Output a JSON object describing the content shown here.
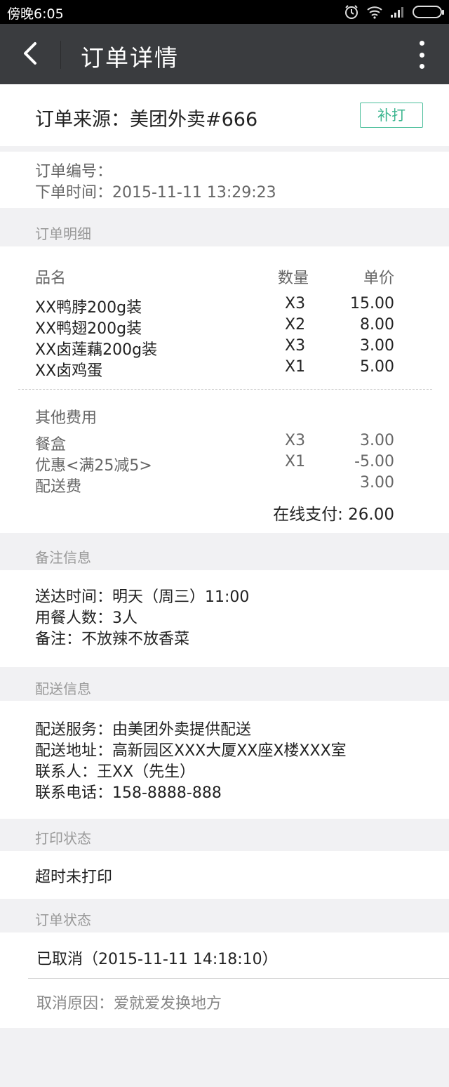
{
  "status_bar": {
    "time": "傍晚6:05",
    "icons": [
      "alarm-icon",
      "wifi-icon",
      "signal-icon",
      "battery-icon"
    ]
  },
  "app_bar": {
    "title": "订单详情"
  },
  "order_source": {
    "text": "订单来源：美团外卖#666",
    "reprint_button": "补打"
  },
  "order_info": {
    "number_label": "订单编号：",
    "time_text": "下单时间：2015-11-11 13:29:23"
  },
  "sections": {
    "detail": "订单明细",
    "remark": "备注信息",
    "delivery": "配送信息",
    "print": "打印状态",
    "status": "订单状态"
  },
  "items_header": {
    "name": "品名",
    "qty": "数量",
    "price": "单价"
  },
  "items": [
    {
      "name": "XX鸭脖200g装",
      "qty": "X3",
      "price": "15.00"
    },
    {
      "name": "XX鸭翅200g装",
      "qty": "X2",
      "price": "8.00"
    },
    {
      "name": "XX卤莲藕200g装",
      "qty": "X3",
      "price": "3.00"
    },
    {
      "name": "XX卤鸡蛋",
      "qty": "X1",
      "price": "5.00"
    }
  ],
  "other_fees": {
    "title": "其他费用",
    "rows": [
      {
        "name": "餐盒",
        "qty": "X3",
        "price": "3.00"
      },
      {
        "name": "优惠<满25减5>",
        "qty": "X1",
        "price": "-5.00"
      },
      {
        "name": "配送费",
        "qty": "",
        "price": "3.00"
      }
    ],
    "total": "在线支付:  26.00"
  },
  "remark": {
    "lines": [
      "送达时间：明天（周三）11:00",
      "用餐人数：3人",
      "备注：不放辣不放香菜"
    ]
  },
  "delivery": {
    "lines": [
      "配送服务：由美团外卖提供配送",
      "配送地址：高新园区XXX大厦XX座X楼XXX室",
      "联系人：王XX（先生）",
      "联系电话：158-8888-888"
    ]
  },
  "print_status": "超时未打印",
  "order_status": {
    "status": "已取消（2015-11-11  14:18:10）",
    "cancel_reason": "取消原因：爱就爱发换地方"
  },
  "colors": {
    "appbar": "#3a3c3f",
    "accent": "#3bb58f",
    "background": "#f1f1f3"
  }
}
